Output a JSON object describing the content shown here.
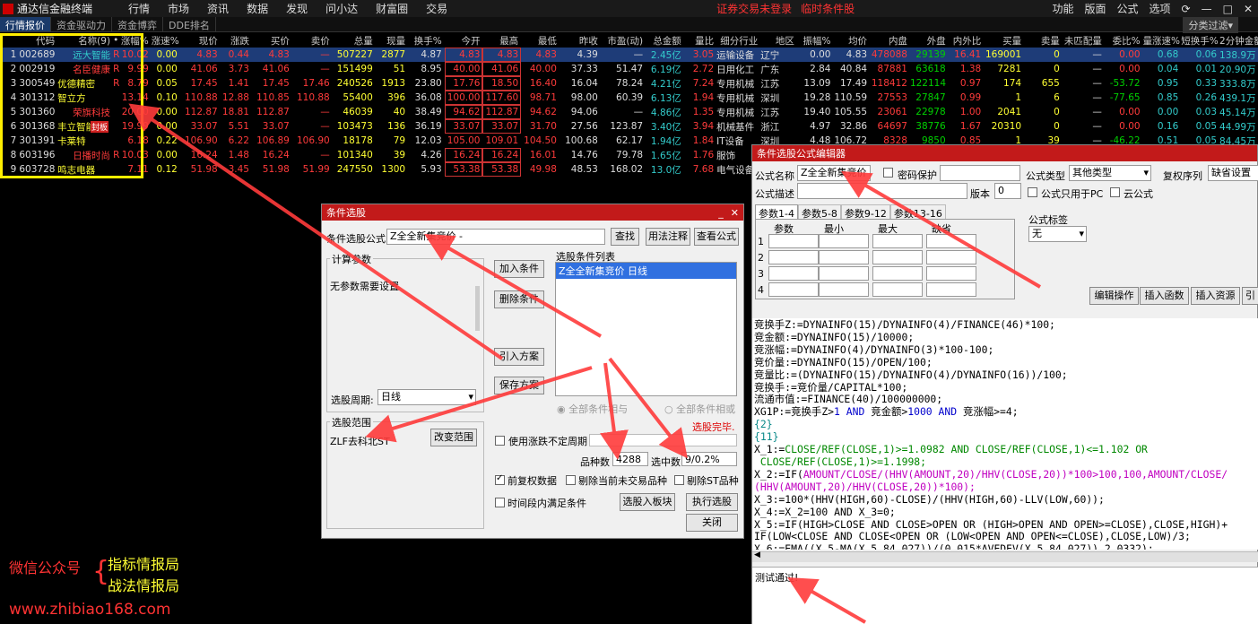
{
  "menubar": {
    "app_title": "通达信金融终端",
    "items": [
      "行情",
      "市场",
      "资讯",
      "数据",
      "发现",
      "问小达",
      "财富圈",
      "交易"
    ],
    "warning_login": "证券交易未登录",
    "warning_cond": "临时条件股",
    "right_items": [
      "功能",
      "版面",
      "公式",
      "选项"
    ]
  },
  "tabs": [
    "行情报价",
    "资金驱动力",
    "资金博弈",
    "DDE排名"
  ],
  "filter_label": "分类过滤▾",
  "table": {
    "headers": [
      "",
      "代码",
      "名称(9)",
      "•",
      "涨幅%",
      "涨速%",
      "现价",
      "涨跌",
      "买价",
      "卖价",
      "总量",
      "现量",
      "换手%",
      "今开",
      "最高",
      "最低",
      "昨收",
      "市盈(动)",
      "总金额",
      "量比",
      "细分行业",
      "地区",
      "振幅%",
      "均价",
      "内盘",
      "外盘",
      "内外比",
      "买量",
      "卖量",
      "未匹配量",
      "委比%",
      "量涨速%",
      "短换手%",
      "2分钟金额"
    ],
    "rows": [
      [
        "1",
        "002689",
        "远大智能",
        "R",
        "10.02",
        "0.00",
        "4.83",
        "0.44",
        "4.83",
        "—",
        "507227",
        "2877",
        "4.87",
        "4.83",
        "4.83",
        "4.83",
        "4.39",
        "—",
        "2.45亿",
        "3.05",
        "运输设备",
        "辽宁",
        "0.00",
        "4.83",
        "478088",
        "29139",
        "16.41",
        "169001",
        "0",
        "—",
        "0.00",
        "0.68",
        "0.06",
        "138.9万"
      ],
      [
        "2",
        "002919",
        "名臣健康",
        "R",
        "9.99",
        "0.00",
        "41.06",
        "3.73",
        "41.06",
        "—",
        "151499",
        "51",
        "8.95",
        "40.00",
        "41.06",
        "40.00",
        "37.33",
        "51.47",
        "6.19亿",
        "2.72",
        "日用化工",
        "广东",
        "2.84",
        "40.84",
        "87881",
        "63618",
        "1.38",
        "7281",
        "0",
        "—",
        "0.00",
        "0.04",
        "0.01",
        "20.90万"
      ],
      [
        "3",
        "300549",
        "优德精密",
        "R",
        "8.79",
        "0.05",
        "17.45",
        "1.41",
        "17.45",
        "17.46",
        "240526",
        "1913",
        "23.80",
        "17.76",
        "18.50",
        "16.40",
        "16.04",
        "78.24",
        "4.21亿",
        "7.24",
        "专用机械",
        "江苏",
        "13.09",
        "17.49",
        "118412",
        "122114",
        "0.97",
        "174",
        "655",
        "—",
        "-53.72",
        "0.95",
        "0.33",
        "333.8万"
      ],
      [
        "4",
        "301312",
        "智立方",
        "",
        "13.14",
        "0.10",
        "110.88",
        "12.88",
        "110.85",
        "110.88",
        "55400",
        "396",
        "36.08",
        "100.00",
        "117.60",
        "98.71",
        "98.00",
        "60.39",
        "6.13亿",
        "1.94",
        "专用机械",
        "深圳",
        "19.28",
        "110.59",
        "27553",
        "27847",
        "0.99",
        "1",
        "6",
        "—",
        "-77.65",
        "0.85",
        "0.26",
        "439.1万"
      ],
      [
        "5",
        "301360",
        "荣旗科技",
        "",
        "20.00",
        "0.00",
        "112.87",
        "18.81",
        "112.87",
        "—",
        "46039",
        "40",
        "38.49",
        "94.62",
        "112.87",
        "94.62",
        "94.06",
        "—",
        "4.86亿",
        "1.35",
        "专用机械",
        "江苏",
        "19.40",
        "105.55",
        "23061",
        "22978",
        "1.00",
        "2041",
        "0",
        "—",
        "0.00",
        "0.00",
        "0.03",
        "45.14万"
      ],
      [
        "6",
        "301368",
        "丰立智能",
        "",
        "19.99",
        "0.00",
        "33.07",
        "5.51",
        "33.07",
        "—",
        "103473",
        "136",
        "36.19",
        "33.07",
        "33.07",
        "31.70",
        "27.56",
        "123.87",
        "3.40亿",
        "3.94",
        "机械基件",
        "浙江",
        "4.97",
        "32.86",
        "64697",
        "38776",
        "1.67",
        "20310",
        "0",
        "—",
        "0.00",
        "0.16",
        "0.05",
        "44.99万"
      ],
      [
        "7",
        "301391",
        "卡莱特",
        "",
        "6.18",
        "0.22",
        "106.90",
        "6.22",
        "106.89",
        "106.90",
        "18178",
        "79",
        "12.03",
        "105.00",
        "109.01",
        "104.50",
        "100.68",
        "62.17",
        "1.94亿",
        "1.84",
        "IT设备",
        "深圳",
        "4.48",
        "106.72",
        "8328",
        "9850",
        "0.85",
        "1",
        "39",
        "—",
        "-46.22",
        "0.51",
        "0.05",
        "84.45万"
      ],
      [
        "8",
        "603196",
        "日播时尚",
        "R",
        "10.03",
        "0.00",
        "16.24",
        "1.48",
        "16.24",
        "—",
        "101340",
        "39",
        "4.26",
        "16.24",
        "16.24",
        "16.01",
        "14.76",
        "79.78",
        "1.65亿",
        "1.76",
        "服饰",
        "",
        "",
        "",
        "",
        "",
        "",
        "",
        "",
        "",
        "",
        "",
        "",
        ""
      ],
      [
        "9",
        "603728",
        "鸣志电器",
        "",
        "7.11",
        "0.12",
        "51.98",
        "3.45",
        "51.98",
        "51.99",
        "247550",
        "1300",
        "5.93",
        "53.38",
        "53.38",
        "49.98",
        "48.53",
        "168.02",
        "13.0亿",
        "7.68",
        "电气设备",
        "",
        "",
        "",
        "",
        "",
        "",
        "",
        "",
        "",
        "",
        "",
        "",
        ""
      ]
    ],
    "limit_badge": "封板"
  },
  "cond_dialog": {
    "title": "条件选股",
    "formula_label": "条件选股公式",
    "formula_value": "Z全全新集竞价  -",
    "btn_find": "查找",
    "btn_usage": "用法注释",
    "btn_view": "查看公式",
    "calc_params_label": "计算参数",
    "no_params": "无参数需要设置",
    "period_label": "选股周期:",
    "period_value": "日线",
    "btn_add": "加入条件",
    "btn_delete": "删除条件",
    "btn_import": "引入方案",
    "btn_save": "保存方案",
    "cond_list_label": "选股条件列表",
    "cond_item": "Z全全新集竞价  日线",
    "radio_and": "全部条件相与",
    "radio_or": "全部条件相或",
    "done_text": "选股完毕.",
    "range_label": "选股范围",
    "range_value": "ZLF去科北ST",
    "btn_change_range": "改变范围",
    "chk_uncertain": "使用涨跌不定周期",
    "count_label": "品种数",
    "count_value": "4288",
    "selected_label": "选中数",
    "selected_value": "9/0.2%",
    "chk_adjusted": "前复权数据",
    "chk_remove_untraded": "剔除当前未交易品种",
    "chk_remove_st": "剔除ST品种",
    "chk_time_period": "时间段内满足条件",
    "btn_to_block": "选股入板块",
    "btn_execute": "执行选股",
    "btn_close": "关闭"
  },
  "editor": {
    "title": "条件选股公式编辑器",
    "name_label": "公式名称",
    "name_value": "Z全全新集竞价",
    "chk_password": "密码保护",
    "type_label": "公式类型",
    "type_value": "其他类型",
    "restore_label": "复权序列",
    "restore_value": "缺省设置",
    "desc_label": "公式描述",
    "version_label": "版本",
    "version_value": "0",
    "chk_pc_only": "公式只用于PC",
    "chk_cloud": "云公式",
    "param_tabs": [
      "参数1-4",
      "参数5-8",
      "参数9-12",
      "参数13-16"
    ],
    "param_headers": [
      "参数",
      "最小",
      "最大",
      "缺省"
    ],
    "param_rows": [
      "1",
      "2",
      "3",
      "4"
    ],
    "tag_label": "公式标签",
    "tag_value": "无",
    "btn_edit_ops": "编辑操作",
    "btn_insert_func": "插入函数",
    "btn_insert_res": "插入资源",
    "btn_more": "引",
    "status_text": "测试通过!"
  },
  "watermark": {
    "prefix": "微信公众号",
    "line1": "指标情报局",
    "line2": "战法情报局",
    "url": "www.zhibiao168.com"
  }
}
